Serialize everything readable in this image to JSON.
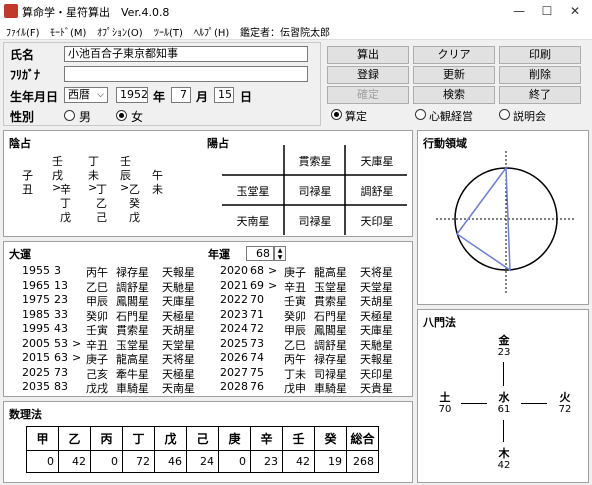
{
  "window": {
    "title": "算命学・星符算出　Ver.4.0.8",
    "minimize": "—",
    "maximize": "☐",
    "close": "✕"
  },
  "menu": [
    {
      "label": "ﾌｧｲﾙ(F)"
    },
    {
      "label": "ﾓｰﾄﾞ(M)"
    },
    {
      "label": "ｵﾌﾟｼｮﾝ(O)"
    },
    {
      "label": "ﾂｰﾙ(T)"
    },
    {
      "label": "ﾍﾙﾌﾟ(H)"
    },
    {
      "label": "鑑定者：伝習院太郎"
    }
  ],
  "form": {
    "name_label": "氏名",
    "name_value": "小池百合子東京都知事",
    "furigana_label": "ﾌﾘｶﾞﾅ",
    "furigana_value": "",
    "birth_label": "生年月日",
    "era": "西暦",
    "year": "1952",
    "year_unit": "年",
    "month": "7",
    "month_unit": "月",
    "day": "15",
    "day_unit": "日",
    "sex_label": "性別",
    "male": "男",
    "female": "女",
    "sex_selected": "女"
  },
  "buttons": {
    "calc": "算出",
    "clear": "クリア",
    "print": "印刷",
    "register": "登録",
    "update": "更新",
    "delete": "削除",
    "confirm": "確定",
    "search": "検索",
    "exit": "終了"
  },
  "mode": {
    "options": [
      "算定",
      "心観経営",
      "説明会"
    ],
    "selected": "算定"
  },
  "inyo": {
    "title": "陰占",
    "rows": [
      [
        "",
        "壬",
        "",
        "丁",
        "",
        "壬",
        "",
        ""
      ],
      [
        "子",
        "戌",
        "",
        "未",
        "",
        "辰",
        "",
        "午"
      ],
      [
        "丑",
        ">",
        "辛",
        ">",
        "丁",
        ">",
        "乙",
        "未"
      ],
      [
        "",
        "",
        "丁",
        "",
        "乙",
        "",
        "癸",
        ""
      ],
      [
        "",
        "",
        "戊",
        "",
        "己",
        "",
        "戊",
        ""
      ]
    ]
  },
  "yosen": {
    "title": "陽占",
    "cells": [
      "",
      "貫索星",
      "天庫星",
      "玉堂星",
      "司禄星",
      "調舒星",
      "天南星",
      "司禄星",
      "天印星"
    ]
  },
  "area": {
    "title": "行動領域"
  },
  "taiun": {
    "title": "大運",
    "nen_label": "年運",
    "nen_value": "68",
    "left": [
      [
        "1955",
        "3",
        "",
        "丙午",
        "禄存星",
        "天報星"
      ],
      [
        "1965",
        "13",
        "",
        "乙巳",
        "調舒星",
        "天馳星"
      ],
      [
        "1975",
        "23",
        "",
        "甲辰",
        "鳳閣星",
        "天庫星"
      ],
      [
        "1985",
        "33",
        "",
        "癸卯",
        "石門星",
        "天極星"
      ],
      [
        "1995",
        "43",
        "",
        "壬寅",
        "貫索星",
        "天胡星"
      ],
      [
        "2005",
        "53",
        ">",
        "辛丑",
        "玉堂星",
        "天堂星"
      ],
      [
        "2015",
        "63",
        ">",
        "庚子",
        "龍高星",
        "天将星"
      ],
      [
        "2025",
        "73",
        "",
        "己亥",
        "牽牛星",
        "天極星"
      ],
      [
        "2035",
        "83",
        "",
        "戊戌",
        "車騎星",
        "天南星"
      ]
    ],
    "right": [
      [
        "2020",
        "68",
        ">",
        "庚子",
        "龍高星",
        "天将星"
      ],
      [
        "2021",
        "69",
        ">",
        "辛丑",
        "玉堂星",
        "天堂星"
      ],
      [
        "2022",
        "70",
        "",
        "壬寅",
        "貫索星",
        "天胡星"
      ],
      [
        "2023",
        "71",
        "",
        "癸卯",
        "石門星",
        "天極星"
      ],
      [
        "2024",
        "72",
        "",
        "甲辰",
        "鳳閣星",
        "天庫星"
      ],
      [
        "2025",
        "73",
        "",
        "乙巳",
        "調舒星",
        "天馳星"
      ],
      [
        "2026",
        "74",
        "",
        "丙午",
        "禄存星",
        "天報星"
      ],
      [
        "2027",
        "75",
        "",
        "丁未",
        "司禄星",
        "天印星"
      ],
      [
        "2028",
        "76",
        "",
        "戊申",
        "車騎星",
        "天貴星"
      ]
    ]
  },
  "suri": {
    "title": "数理法",
    "headers": [
      "甲",
      "乙",
      "丙",
      "丁",
      "戊",
      "己",
      "庚",
      "辛",
      "壬",
      "癸",
      "総合"
    ],
    "values": [
      "0",
      "42",
      "0",
      "72",
      "46",
      "24",
      "0",
      "23",
      "42",
      "19",
      "268"
    ]
  },
  "hachimon": {
    "title": "八門法",
    "north_label": "金",
    "north_value": "23",
    "west_label": "土",
    "west_value": "70",
    "center_label": "水",
    "center_value": "61",
    "east_label": "火",
    "east_value": "72",
    "south_label": "木",
    "south_value": "42"
  },
  "colors": {
    "polygon": "#6b7fd7",
    "title_red": "#c0392b"
  }
}
